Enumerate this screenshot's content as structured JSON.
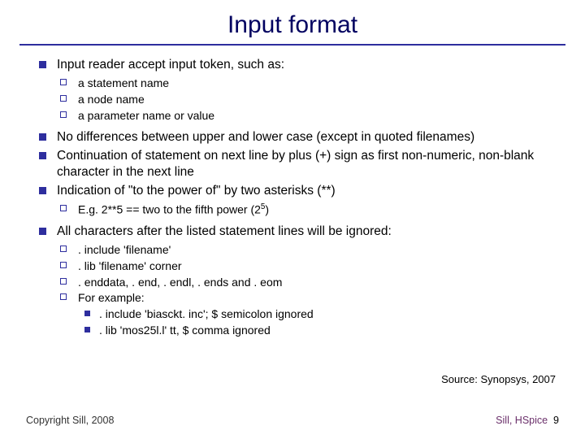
{
  "title": "Input format",
  "b1": "Input reader accept input token, such as:",
  "b1s1": "a statement name",
  "b1s2": "a node name",
  "b1s3": "a parameter name or value",
  "b2": "No differences between upper and lower case (except in quoted filenames)",
  "b3": "Continuation of statement on next line by plus (+) sign as first non-numeric, non-blank character in the next line",
  "b4": "Indication of \"to the power of\" by two asterisks (**)",
  "b4s1_pre": "E.g. 2**5 == two to the fifth power (2",
  "b4s1_sup": "5",
  "b4s1_post": ")",
  "b5": "All characters after the listed statement lines will be ignored:",
  "b5s1": ". include 'filename'",
  "b5s2": ". lib 'filename' corner",
  "b5s3": ". enddata, . end, . endl, . ends and . eom",
  "b5s4": "For example:",
  "b5s4a": ". include 'biasckt. inc'; $ semicolon ignored",
  "b5s4b": ". lib 'mos25l.l' tt, $ comma ignored",
  "source": "Source: Synopsys, 2007",
  "copyright": "Copyright Sill, 2008",
  "footer_series": "Sill, HSpice",
  "page": "9"
}
